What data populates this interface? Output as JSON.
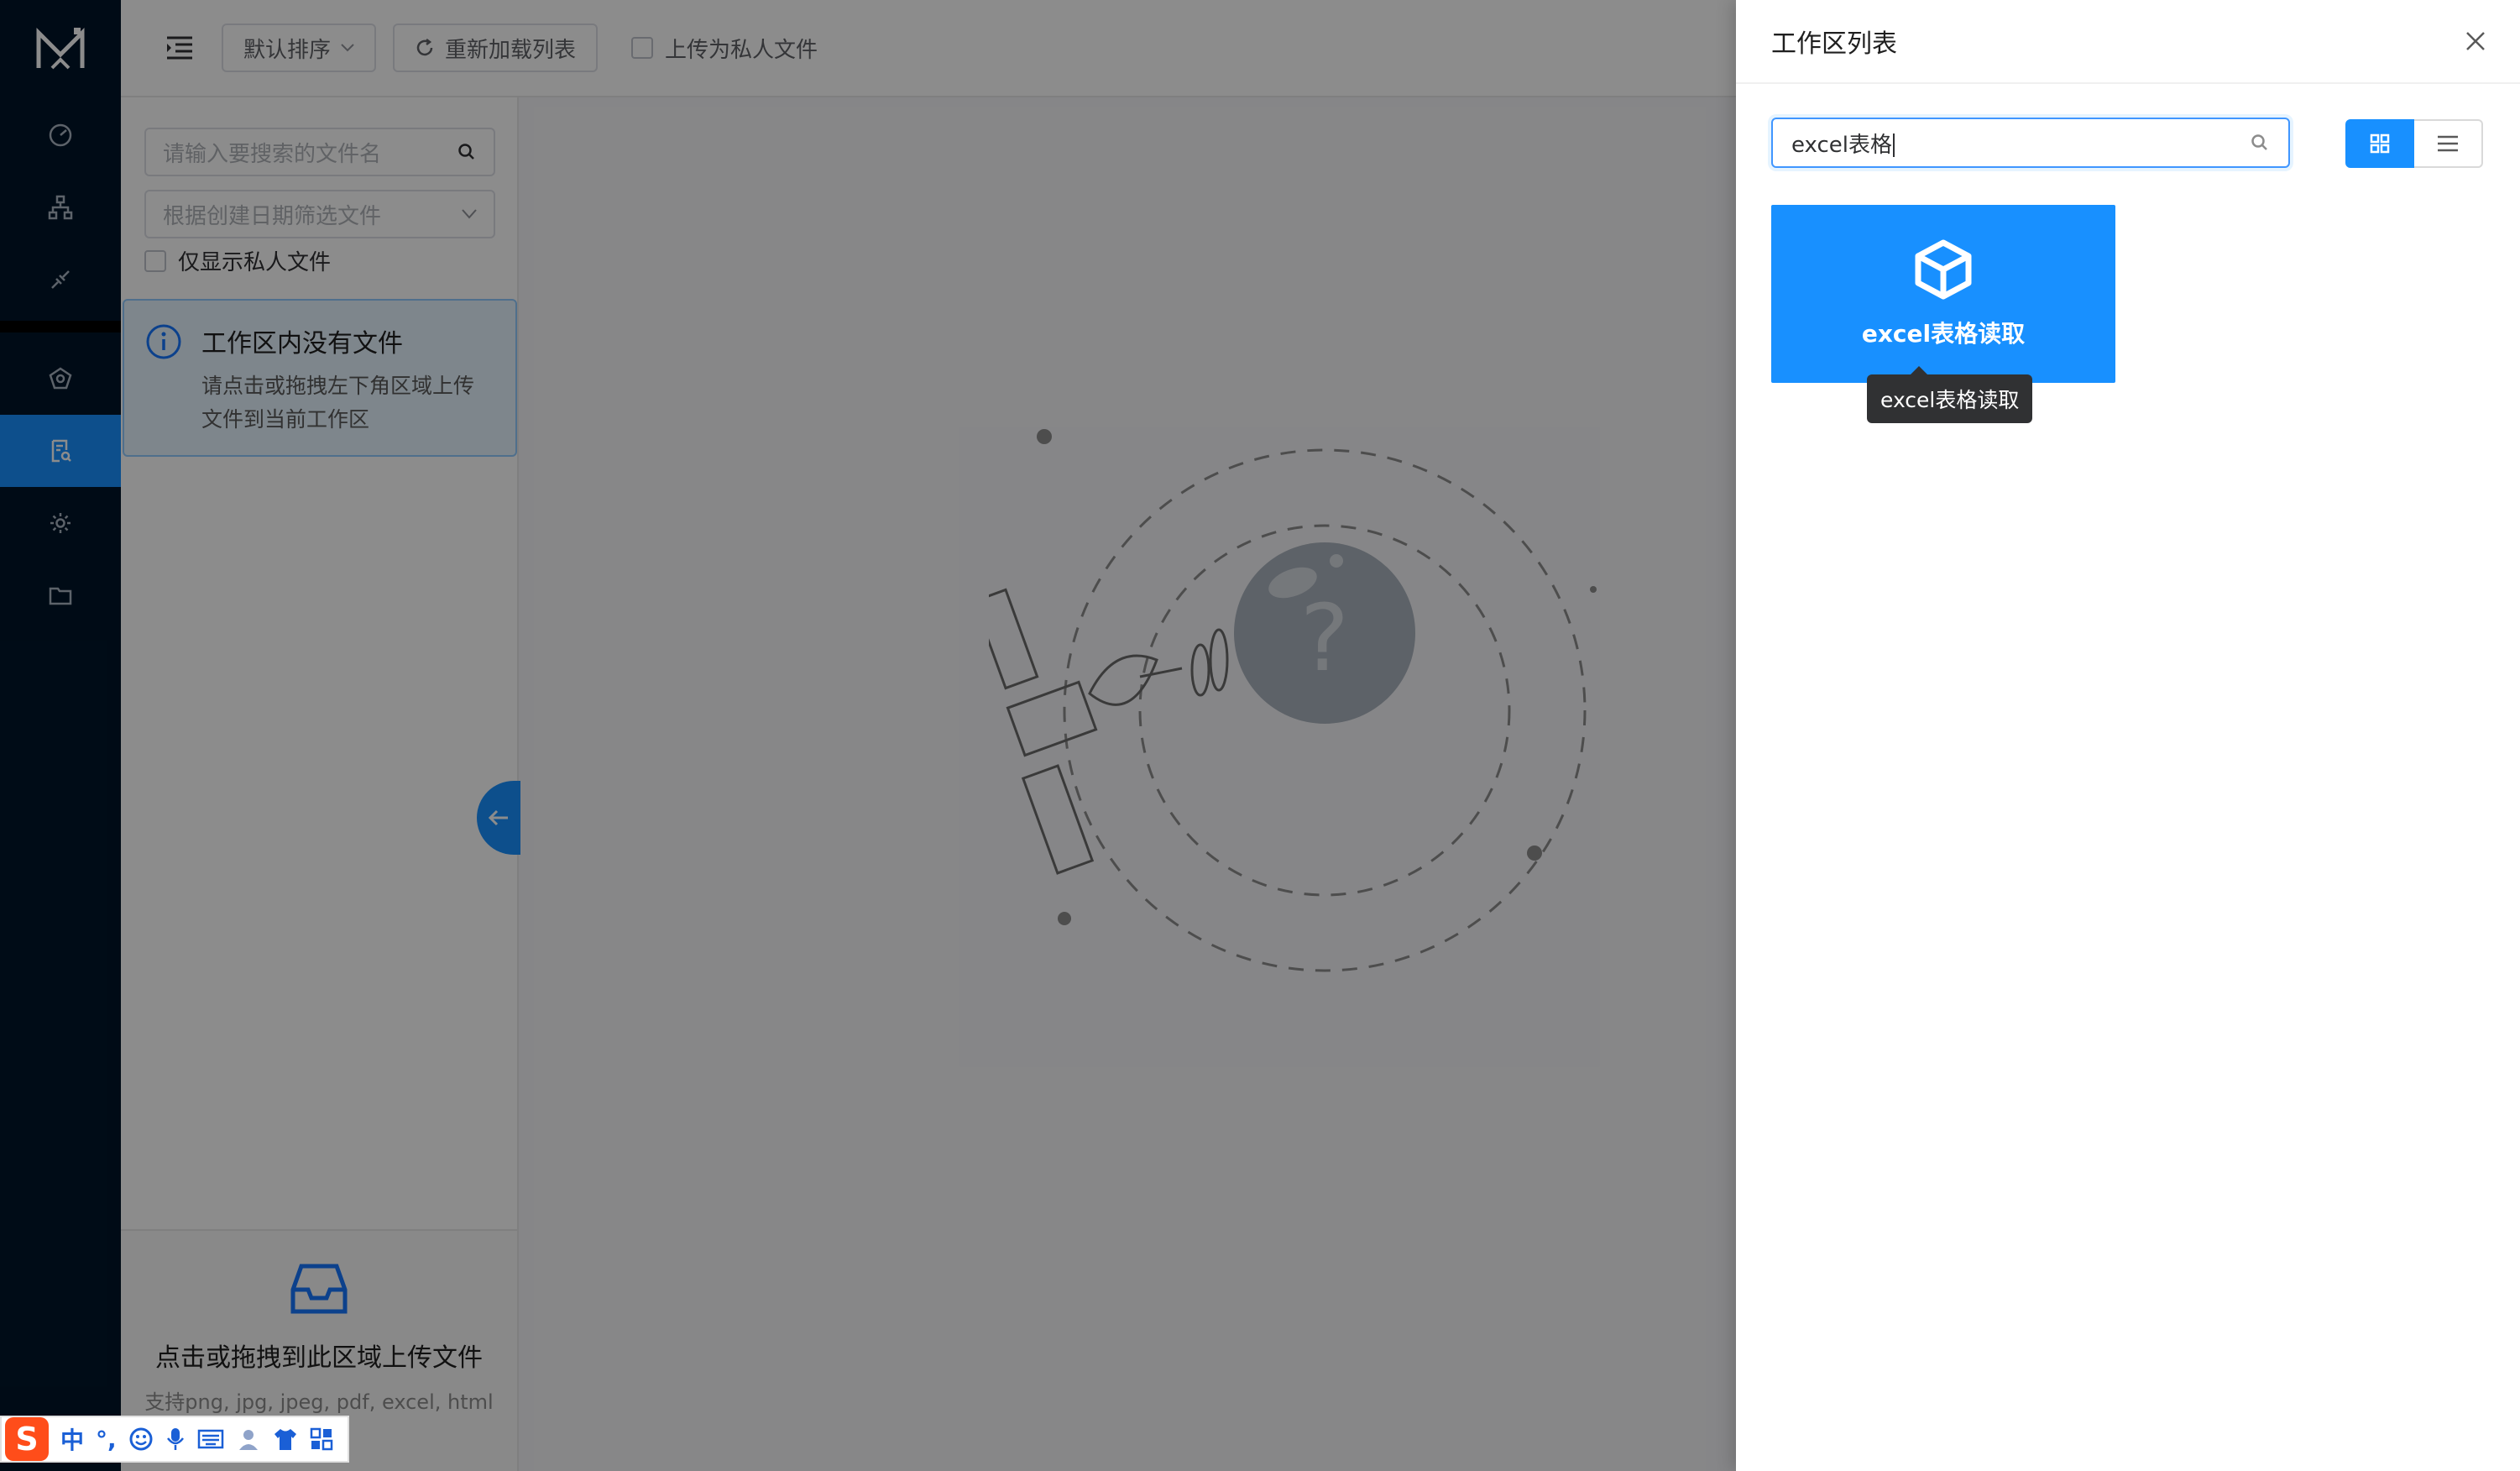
{
  "topbar": {
    "sort_label": "默认排序",
    "reload_label": "重新加载列表",
    "private_upload_label": "上传为私人文件"
  },
  "leftpanel": {
    "search_placeholder": "请输入要搜索的文件名",
    "date_filter_placeholder": "根据创建日期筛选文件",
    "private_only_label": "仅显示私人文件",
    "alert_title": "工作区内没有文件",
    "alert_desc": "请点击或拖拽左下角区域上传文件到当前工作区",
    "upload_title": "点击或拖拽到此区域上传文件",
    "upload_hint": "支持png, jpg, jpeg, pdf, excel, html"
  },
  "drawer": {
    "title": "工作区列表",
    "search_value": "excel表格",
    "card_label": "excel表格读取",
    "tooltip": "excel表格读取"
  },
  "ime": {
    "logo": "S",
    "mode": "中",
    "punct": "°,"
  },
  "colors": {
    "sidebar_bg": "#001529",
    "accent": "#1890ff"
  }
}
